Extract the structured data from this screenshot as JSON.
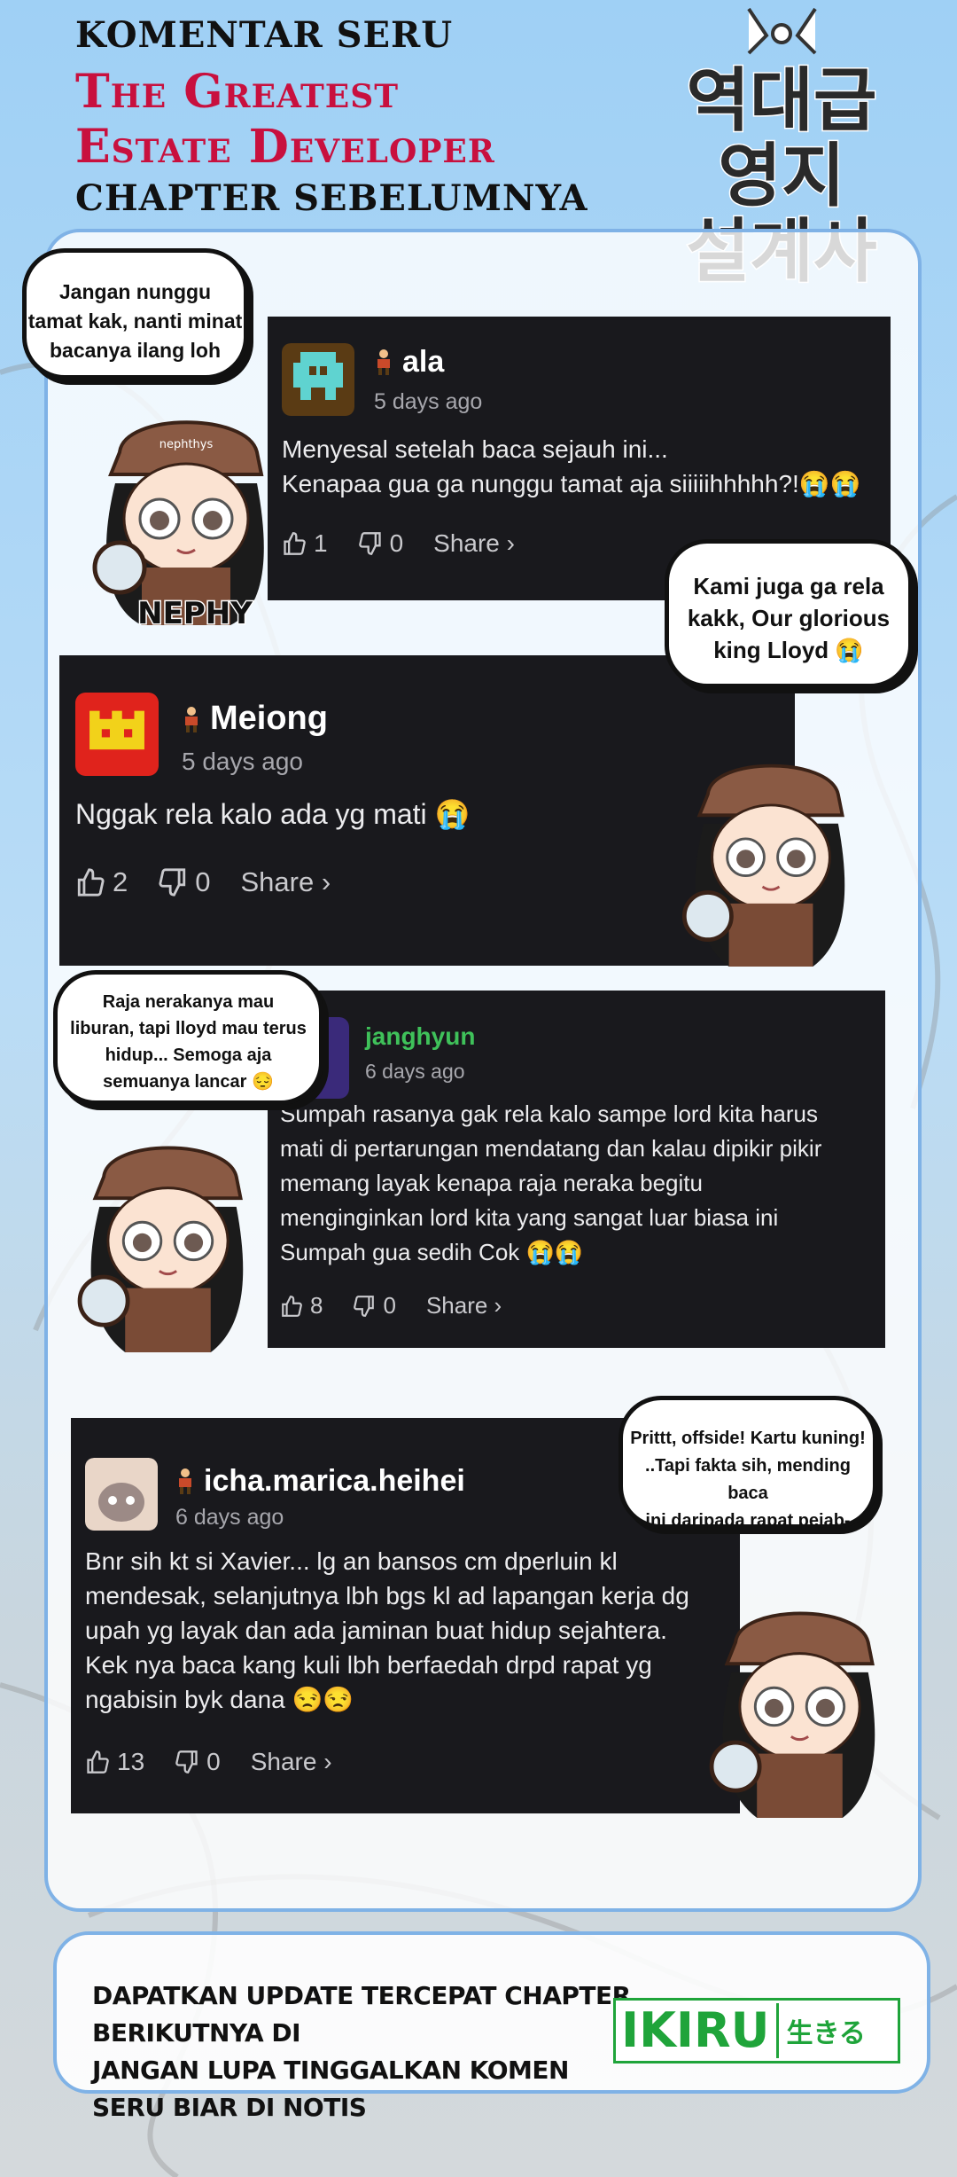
{
  "header": {
    "line1": "KOMENTAR SERU",
    "line2": "The Greatest",
    "line3": "Estate Developer",
    "line4": "CHAPTER SEBELUMNYA",
    "logo_text": [
      "역대급",
      "영지",
      "설계사"
    ]
  },
  "comments": [
    {
      "user": "ala",
      "time": "5 days ago",
      "text": [
        "Menyesal setelah baca sejauh ini...",
        "Kenapaa gua ga nunggu tamat aja siiiiihhhhh?!😭😭"
      ],
      "likes": "1",
      "dislikes": "0",
      "share": "Share ›",
      "avatar_color": "#5fd3d0",
      "bubble": [
        "Jangan nunggu",
        "tamat kak, nanti minat",
        "bacanya ilang loh"
      ]
    },
    {
      "user": "Meiong",
      "time": "5 days ago",
      "text": [
        "Nggak rela kalo ada yg mati 😭"
      ],
      "likes": "2",
      "dislikes": "0",
      "share": "Share ›",
      "avatar_color": "#e0231c",
      "bubble": [
        "Kami juga ga rela",
        "kakk, Our glorious",
        "king Lloyd 😭"
      ]
    },
    {
      "user": "janghyun",
      "time": "6 days ago",
      "text": [
        "Sumpah rasanya gak rela kalo sampe lord kita harus",
        "mati di pertarungan mendatang dan kalau dipikir pikir",
        "memang layak kenapa raja neraka begitu",
        "menginginkan lord kita yang sangat luar biasa ini",
        "Sumpah gua sedih Cok 😭😭"
      ],
      "likes": "8",
      "dislikes": "0",
      "share": "Share ›",
      "name_color": "#3fc15a",
      "bubble": [
        "Raja nerakanya mau",
        "liburan, tapi lloyd mau terus",
        "hidup... Semoga aja",
        "semuanya lancar 😔"
      ]
    },
    {
      "user": "icha.marica.heihei",
      "time": "6 days ago",
      "text": [
        "Bnr sih kt si Xavier... lg an bansos cm dperluin kl",
        "mendesak, selanjutnya lbh bgs kl ad lapangan kerja dg",
        "upah yg layak dan ada jaminan buat hidup sejahtera.",
        "Kek nya baca kang kuli lbh berfaedah drpd rapat yg",
        "ngabisin byk dana 😒😒"
      ],
      "likes": "13",
      "dislikes": "0",
      "share": "Share ›",
      "bubble": [
        "Prittt, offside! Kartu kuning!",
        "..Tapi fakta sih, mending baca",
        "ini daripada rapat pejab-"
      ]
    }
  ],
  "nephy_label": "NEPHY",
  "hat_label": "nephthys",
  "footer": {
    "line1": "DAPATKAN UPDATE TERCEPAT CHAPTER BERIKUTNYA DI",
    "line2": "JANGAN LUPA TINGGALKAN KOMEN SERU BIAR DI NOTIS",
    "brand": "IKIRU",
    "brand_jp": "生きる"
  },
  "colors": {
    "accent_red": "#c8103e",
    "brand_green": "#1fa43a",
    "card_bg": "#19191d",
    "panel_border": "#7fb2e6"
  }
}
